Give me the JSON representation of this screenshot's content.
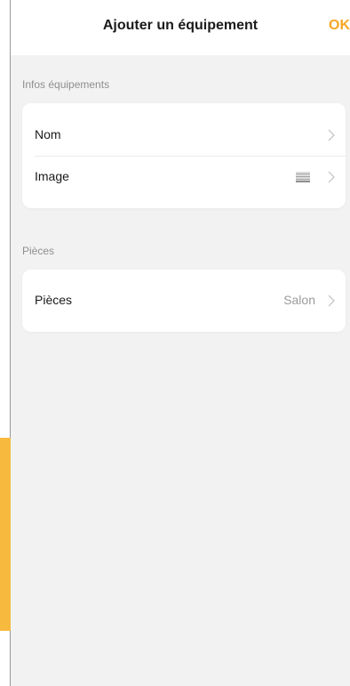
{
  "nav": {
    "title": "Ajouter un équipement",
    "ok_label": "OK"
  },
  "sections": [
    {
      "label": "Infos équipements",
      "rows": [
        {
          "label": "Nom",
          "value": "",
          "icon": "chevron-right-icon"
        },
        {
          "label": "Image",
          "value": "",
          "icon": "image-thumbnail-icon"
        }
      ]
    },
    {
      "label": "Pièces",
      "rows": [
        {
          "label": "Pièces",
          "value": "Salon",
          "icon": "chevron-right-icon"
        }
      ]
    }
  ],
  "colors": {
    "accent": "#f5a623",
    "accent_bar": "#f7b93e",
    "background": "#f2f2f2",
    "card": "#ffffff",
    "chevron": "#c7c7c7"
  }
}
